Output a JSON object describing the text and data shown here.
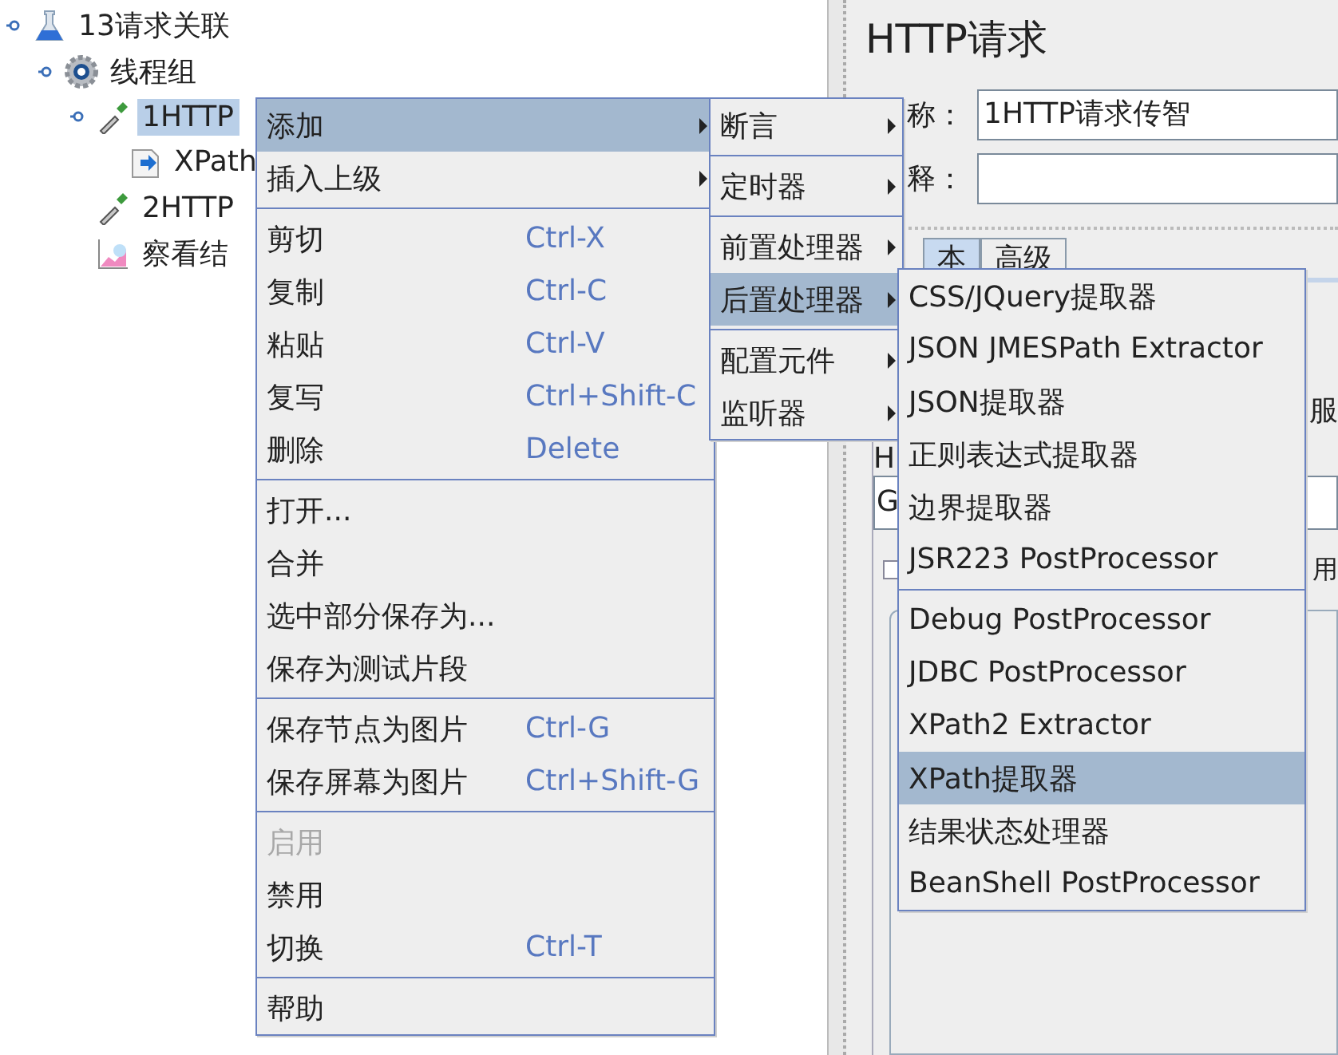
{
  "tree": [
    {
      "label": "13请求关联",
      "kind": "testplan",
      "expanded": true,
      "selected": false,
      "children": [
        {
          "label": "线程组",
          "kind": "threadgroup",
          "expanded": true,
          "selected": false,
          "children": [
            {
              "label": "1HTTP",
              "kind": "sampler",
              "expanded": true,
              "selected": true,
              "children": [
                {
                  "label": "XPath",
                  "kind": "postprocessor",
                  "expanded": false,
                  "selected": false
                }
              ]
            },
            {
              "label": "2HTTP",
              "kind": "sampler",
              "expanded": false,
              "selected": false
            },
            {
              "label": "察看结",
              "kind": "listener",
              "expanded": false,
              "selected": false
            }
          ]
        }
      ]
    }
  ],
  "editor": {
    "title": "HTTP请求",
    "name_label": "称：",
    "name_value": "1HTTP请求传智",
    "comment_label": "释：",
    "tabs": [
      {
        "label": "本",
        "selected": true
      },
      {
        "label": "高级",
        "selected": false
      }
    ],
    "server_fragment": "服",
    "protocol_label": "H",
    "method_value": "G",
    "checkbox_fragment": "用",
    "checkbox_checked": false
  },
  "context_menu": [
    [
      {
        "label": "添加",
        "submenu": true,
        "disabled": false,
        "selected": true
      },
      {
        "label": "插入上级",
        "submenu": true,
        "disabled": false,
        "selected": false
      }
    ],
    [
      {
        "label": "剪切",
        "shortcut": "Ctrl-X",
        "submenu": false,
        "disabled": false,
        "selected": false
      },
      {
        "label": "复制",
        "shortcut": "Ctrl-C",
        "submenu": false,
        "disabled": false,
        "selected": false
      },
      {
        "label": "粘贴",
        "shortcut": "Ctrl-V",
        "submenu": false,
        "disabled": false,
        "selected": false
      },
      {
        "label": "复写",
        "shortcut": "Ctrl+Shift-C",
        "submenu": false,
        "disabled": false,
        "selected": false
      },
      {
        "label": "删除",
        "shortcut": "Delete",
        "submenu": false,
        "disabled": false,
        "selected": false
      }
    ],
    [
      {
        "label": "打开...",
        "submenu": false,
        "disabled": false,
        "selected": false
      },
      {
        "label": "合并",
        "submenu": false,
        "disabled": false,
        "selected": false
      },
      {
        "label": "选中部分保存为...",
        "submenu": false,
        "disabled": false,
        "selected": false
      },
      {
        "label": "保存为测试片段",
        "submenu": false,
        "disabled": false,
        "selected": false
      }
    ],
    [
      {
        "label": "保存节点为图片",
        "shortcut": "Ctrl-G",
        "submenu": false,
        "disabled": false,
        "selected": false
      },
      {
        "label": "保存屏幕为图片",
        "shortcut": "Ctrl+Shift-G",
        "submenu": false,
        "disabled": false,
        "selected": false
      }
    ],
    [
      {
        "label": "启用",
        "submenu": false,
        "disabled": true,
        "selected": false
      },
      {
        "label": "禁用",
        "submenu": false,
        "disabled": false,
        "selected": false
      },
      {
        "label": "切换",
        "shortcut": "Ctrl-T",
        "submenu": false,
        "disabled": false,
        "selected": false
      }
    ],
    [
      {
        "label": "帮助",
        "submenu": false,
        "disabled": false,
        "selected": false
      }
    ]
  ],
  "add_menu": [
    [
      {
        "label": "断言",
        "selected": false
      }
    ],
    [
      {
        "label": "定时器",
        "selected": false
      }
    ],
    [
      {
        "label": "前置处理器",
        "selected": false
      },
      {
        "label": "后置处理器",
        "selected": true
      }
    ],
    [
      {
        "label": "配置元件",
        "selected": false
      },
      {
        "label": "监听器",
        "selected": false
      }
    ]
  ],
  "post_processor_menu": [
    [
      {
        "label": "CSS/JQuery提取器",
        "selected": false
      },
      {
        "label": "JSON JMESPath Extractor",
        "selected": false
      },
      {
        "label": "JSON提取器",
        "selected": false
      },
      {
        "label": "正则表达式提取器",
        "selected": false
      },
      {
        "label": "边界提取器",
        "selected": false
      },
      {
        "label": "JSR223 PostProcessor",
        "selected": false
      }
    ],
    [
      {
        "label": "Debug PostProcessor",
        "selected": false
      },
      {
        "label": "JDBC PostProcessor",
        "selected": false
      },
      {
        "label": "XPath2 Extractor",
        "selected": false
      },
      {
        "label": "XPath提取器",
        "selected": true
      },
      {
        "label": "结果状态处理器",
        "selected": false
      },
      {
        "label": "BeanShell PostProcessor",
        "selected": false
      }
    ]
  ]
}
